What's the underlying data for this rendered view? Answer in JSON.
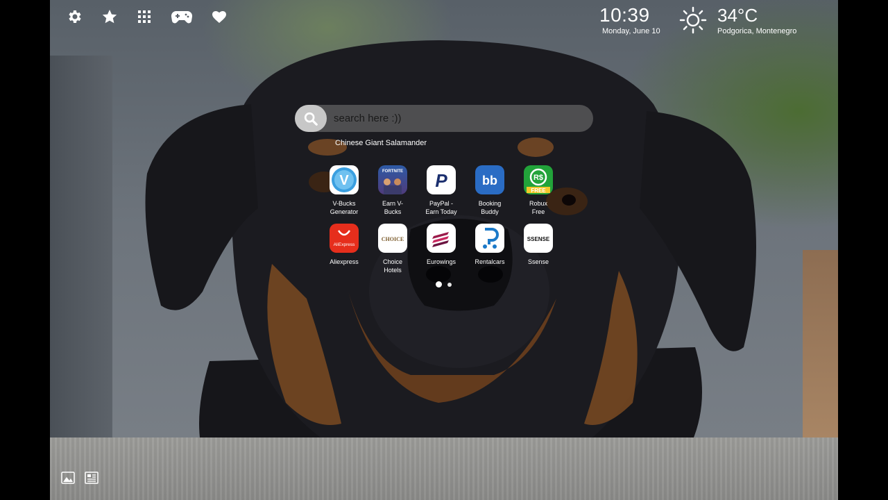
{
  "toolbar": {
    "items": [
      {
        "icon": "gear-icon"
      },
      {
        "icon": "star-icon"
      },
      {
        "icon": "grid-icon"
      },
      {
        "icon": "gamepad-icon"
      },
      {
        "icon": "heart-icon"
      }
    ]
  },
  "clock": {
    "time": "10:39",
    "date": "Monday, June 10"
  },
  "weather": {
    "temp": "34°C",
    "location": "Podgorica, Montenegro",
    "icon": "sun-icon"
  },
  "search": {
    "placeholder": "search here :))",
    "suggestion": "Chinese Giant Salamander"
  },
  "apps": [
    {
      "label_1": "V-Bucks",
      "label_2": "Generator",
      "bg": "#2a8fd6",
      "glyph": "V"
    },
    {
      "label_1": "Earn V-",
      "label_2": "Bucks",
      "bg": "#2c4a8a",
      "glyph": "FORTNITE"
    },
    {
      "label_1": "PayPal -",
      "label_2": "Earn Today",
      "bg": "#ffffff",
      "glyph": "P"
    },
    {
      "label_1": "Booking",
      "label_2": "Buddy",
      "bg": "#2a6cc4",
      "glyph": "bb"
    },
    {
      "label_1": "Robux",
      "label_2": "Free",
      "bg": "#22a33a",
      "glyph": "R$"
    },
    {
      "label_1": "Aliexpress",
      "label_2": "",
      "bg": "#e62e1c",
      "glyph": "AliExpress"
    },
    {
      "label_1": "Choice",
      "label_2": "Hotels",
      "bg": "#ffffff",
      "glyph": "CHOICE"
    },
    {
      "label_1": "Eurowings",
      "label_2": "",
      "bg": "#ffffff",
      "glyph": "≡"
    },
    {
      "label_1": "Rentalcars",
      "label_2": "",
      "bg": "#ffffff",
      "glyph": "R"
    },
    {
      "label_1": "Ssense",
      "label_2": "",
      "bg": "#ffffff",
      "glyph": "SSENSE"
    }
  ],
  "pagination": {
    "pages": 2,
    "current": 1
  },
  "bottom": {
    "icons": [
      "image-icon",
      "news-icon"
    ]
  }
}
